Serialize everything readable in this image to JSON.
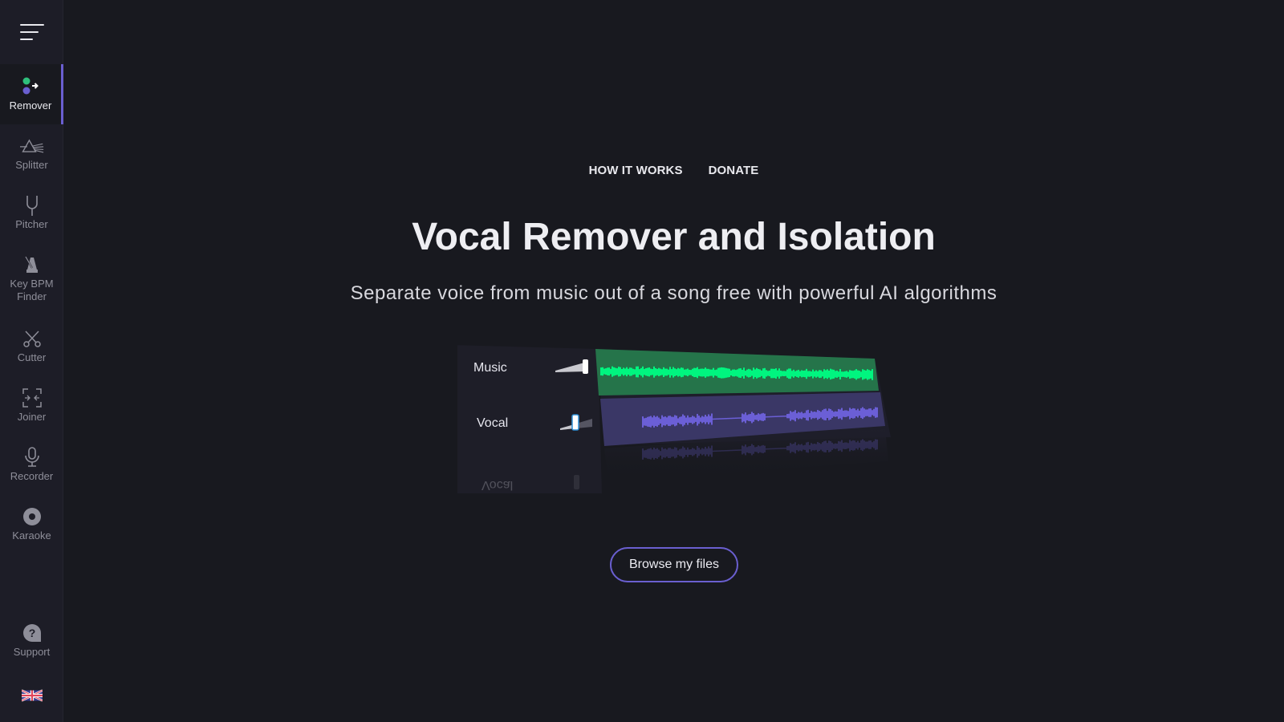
{
  "sidebar": {
    "menu_icon": "hamburger-menu-icon",
    "items": [
      {
        "label": "Remover",
        "icon": "remover-dots-icon",
        "active": true
      },
      {
        "label": "Splitter",
        "icon": "prism-icon",
        "active": false
      },
      {
        "label": "Pitcher",
        "icon": "tuning-fork-icon",
        "active": false
      },
      {
        "label": "Key BPM Finder",
        "icon": "metronome-icon",
        "active": false
      },
      {
        "label": "Cutter",
        "icon": "scissors-icon",
        "active": false
      },
      {
        "label": "Joiner",
        "icon": "joiner-arrows-icon",
        "active": false
      },
      {
        "label": "Recorder",
        "icon": "microphone-icon",
        "active": false
      },
      {
        "label": "Karaoke",
        "icon": "disc-icon",
        "active": false
      }
    ],
    "support": {
      "label": "Support",
      "icon": "help-bubble-icon"
    },
    "language": {
      "icon": "uk-flag-icon"
    }
  },
  "header": {
    "links": [
      "HOW IT WORKS",
      "DONATE"
    ]
  },
  "hero": {
    "title": "Vocal Remover and Isolation",
    "subtitle": "Separate voice from music out of a song free with powerful AI algorithms"
  },
  "mixer": {
    "tracks": [
      {
        "label": "Music",
        "volume": 1.0,
        "color": "#00f57f",
        "bg": "#25744a"
      },
      {
        "label": "Vocal",
        "volume": 0.3,
        "color": "#6b5fd6",
        "bg": "#3a3766"
      }
    ],
    "reflection_label": "Vocal"
  },
  "actions": {
    "browse_label": "Browse my files"
  },
  "colors": {
    "accent": "#6a5fd0",
    "green": "#2fbf7c",
    "purple": "#6a5fd0"
  }
}
